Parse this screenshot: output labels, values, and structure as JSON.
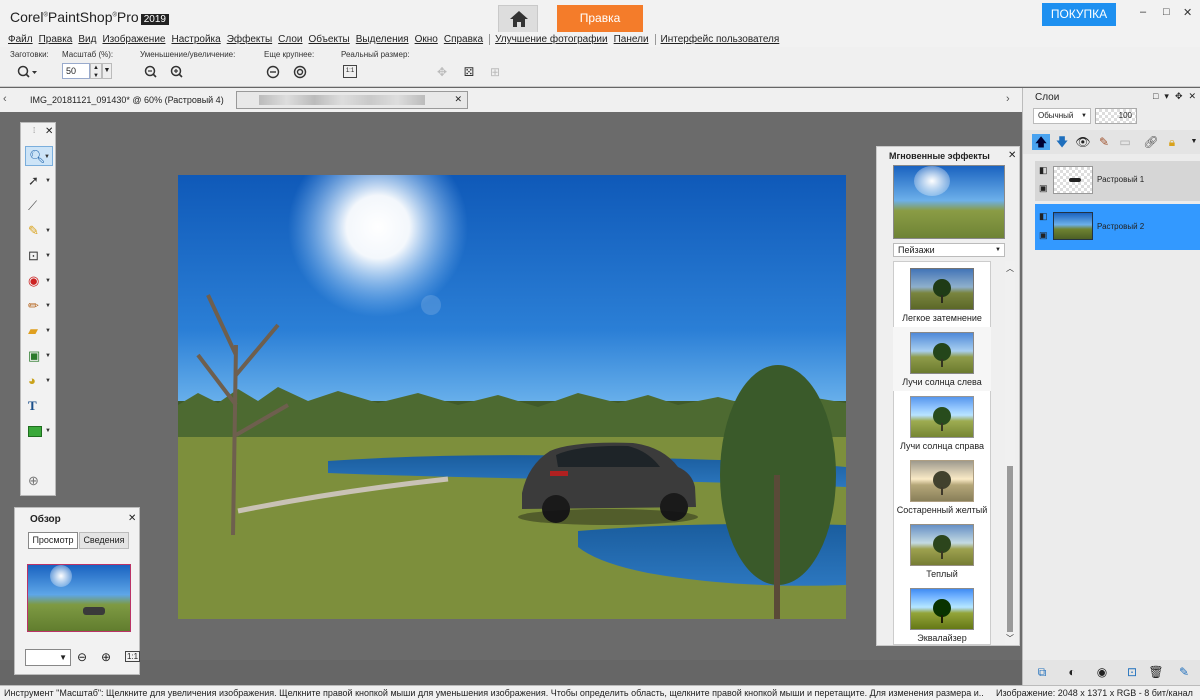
{
  "app": {
    "brand": "Corel",
    "product": "PaintShop",
    "suffix": "Pro",
    "year": "2019"
  },
  "titlebar": {
    "home_icon": "home-icon",
    "edit_tab": "Правка",
    "buy_button": "ПОКУПКА",
    "minimize": "–",
    "restore": "□",
    "close": "✕"
  },
  "menu": [
    "Файл",
    "Правка",
    "Вид",
    "Изображение",
    "Настройка",
    "Эффекты",
    "Слои",
    "Объекты",
    "Выделения",
    "Окно",
    "Справка",
    "Улучшение фотографии",
    "Панели",
    "Интерфейс пользователя"
  ],
  "options": {
    "presets_label": "Заготовки:",
    "scale_label": "Масштаб (%):",
    "scale_value": "50",
    "zoom_label": "Уменьшение/увеличение:",
    "more_label": "Еще крупнее:",
    "actual_label": "Реальный размер:",
    "actual_btn": "1:1"
  },
  "tabs": {
    "active": "IMG_20181121_091430* @  60% (Растровый 4)",
    "close": "✕"
  },
  "overview": {
    "title": "Обзор",
    "tab_preview": "Просмотр",
    "tab_info": "Сведения"
  },
  "effects": {
    "title": "Мгновенные эффекты",
    "category": "Пейзажи",
    "items": [
      {
        "label": "Легкое затемнение"
      },
      {
        "label": "Лучи солнца слева"
      },
      {
        "label": "Лучи солнца справа"
      },
      {
        "label": "Состаренный желтый"
      },
      {
        "label": "Теплый"
      },
      {
        "label": "Эквалайзер"
      }
    ]
  },
  "layers": {
    "title": "Слои",
    "blend_mode": "Обычный",
    "opacity": "100",
    "items": [
      {
        "name": "Растровый 1",
        "selected": false
      },
      {
        "name": "Растровый 2",
        "selected": true
      }
    ]
  },
  "status": {
    "hint": "Инструмент \"Масштаб\": Щелкните для увеличения изображения. Щелкните правой кнопкой мыши для уменьшения изображения. Чтобы определить область, щелкните правой кнопкой мыши и перетащите. Для изменения размера и...",
    "image_info": "Изображение:  2048 x 1371 x RGB - 8 бит/канал"
  },
  "colors": {
    "accent": "#f47c2a",
    "buy": "#1e90f0",
    "layer_selected": "#3399ff"
  }
}
